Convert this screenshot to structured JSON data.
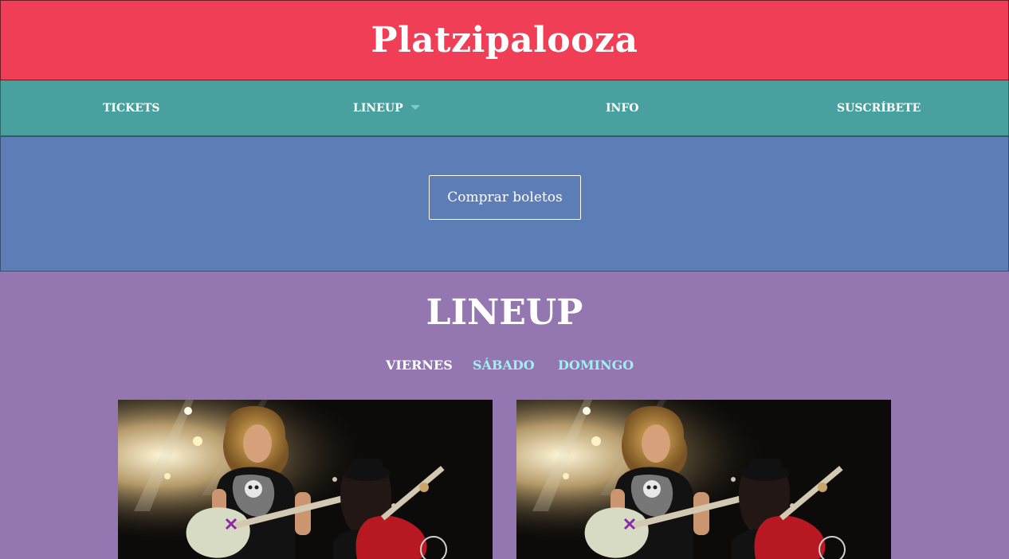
{
  "header": {
    "title": "Platzipalooza"
  },
  "nav": {
    "items": [
      {
        "label": "TICKETS"
      },
      {
        "label": "LINEUP"
      },
      {
        "label": "INFO"
      },
      {
        "label": "SUSCRÍBETE"
      }
    ]
  },
  "hero": {
    "cta_label": "Comprar boletos"
  },
  "lineup": {
    "title": "LINEUP",
    "tabs": [
      {
        "label": "VIERNES",
        "active": true
      },
      {
        "label": "SÁBADO",
        "active": false
      },
      {
        "label": "DOMINGO",
        "active": false
      }
    ],
    "cards": [
      {
        "image": "concert-guitarists-photo"
      },
      {
        "image": "concert-guitarists-photo"
      }
    ]
  },
  "colors": {
    "header_bg": "#ef3e56",
    "nav_bg": "#48a19e",
    "hero_bg": "#5d7db6",
    "lineup_bg": "#9476b0",
    "tab_link": "#9ff0f2"
  }
}
